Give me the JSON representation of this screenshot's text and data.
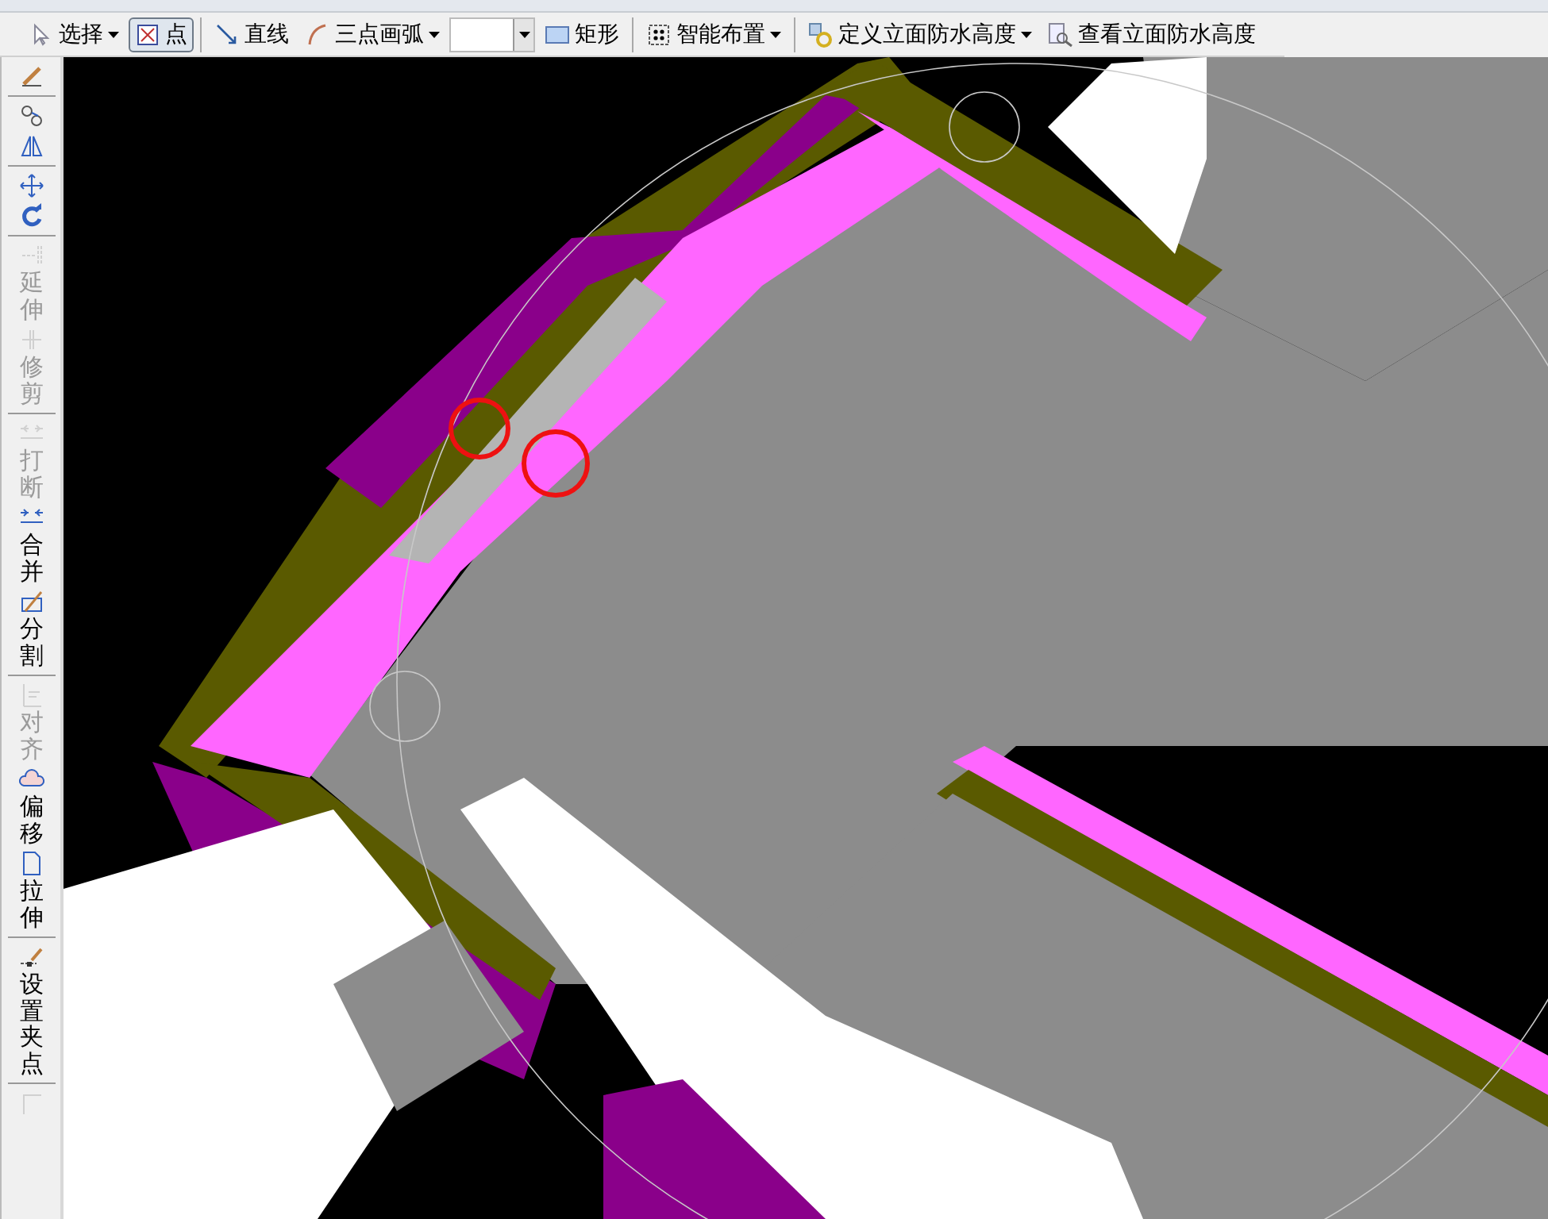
{
  "toolbar": [
    {
      "kind": "dropdown",
      "label": "选择",
      "selected": false
    },
    {
      "kind": "toggle",
      "label": "点",
      "selected": true
    },
    {
      "kind": "sep"
    },
    {
      "kind": "button",
      "label": "直线",
      "selected": false
    },
    {
      "kind": "dropdown",
      "label": "三点画弧",
      "selected": false
    },
    {
      "kind": "combo"
    },
    {
      "kind": "button",
      "label": "矩形",
      "selected": false
    },
    {
      "kind": "sep"
    },
    {
      "kind": "dropdown",
      "label": "智能布置",
      "selected": false
    },
    {
      "kind": "sep"
    },
    {
      "kind": "dropdown",
      "label": "定义立面防水高度",
      "selected": false
    },
    {
      "kind": "button",
      "label": "查看立面防水高度",
      "selected": false
    }
  ],
  "side_tools": [
    {
      "kind": "icon",
      "disabled": false
    },
    {
      "kind": "sep"
    },
    {
      "kind": "icon",
      "disabled": false
    },
    {
      "kind": "icon",
      "disabled": false
    },
    {
      "kind": "sep"
    },
    {
      "kind": "icon",
      "disabled": false
    },
    {
      "kind": "icon",
      "disabled": false
    },
    {
      "kind": "sep"
    },
    {
      "kind": "tool",
      "label": "延伸",
      "disabled": true
    },
    {
      "kind": "tool",
      "label": "修剪",
      "disabled": true
    },
    {
      "kind": "sep"
    },
    {
      "kind": "tool",
      "label": "打断",
      "disabled": true
    },
    {
      "kind": "tool",
      "label": "合并",
      "disabled": false
    },
    {
      "kind": "tool",
      "label": "分割",
      "disabled": false
    },
    {
      "kind": "sep"
    },
    {
      "kind": "tool",
      "label": "对齐",
      "disabled": true
    },
    {
      "kind": "tool",
      "label": "偏移",
      "disabled": false
    },
    {
      "kind": "tool",
      "label": "拉伸",
      "disabled": false
    },
    {
      "kind": "sep"
    },
    {
      "kind": "tool",
      "label": "设置夹点",
      "disabled": false
    },
    {
      "kind": "sep"
    },
    {
      "kind": "icon",
      "disabled": true
    }
  ]
}
